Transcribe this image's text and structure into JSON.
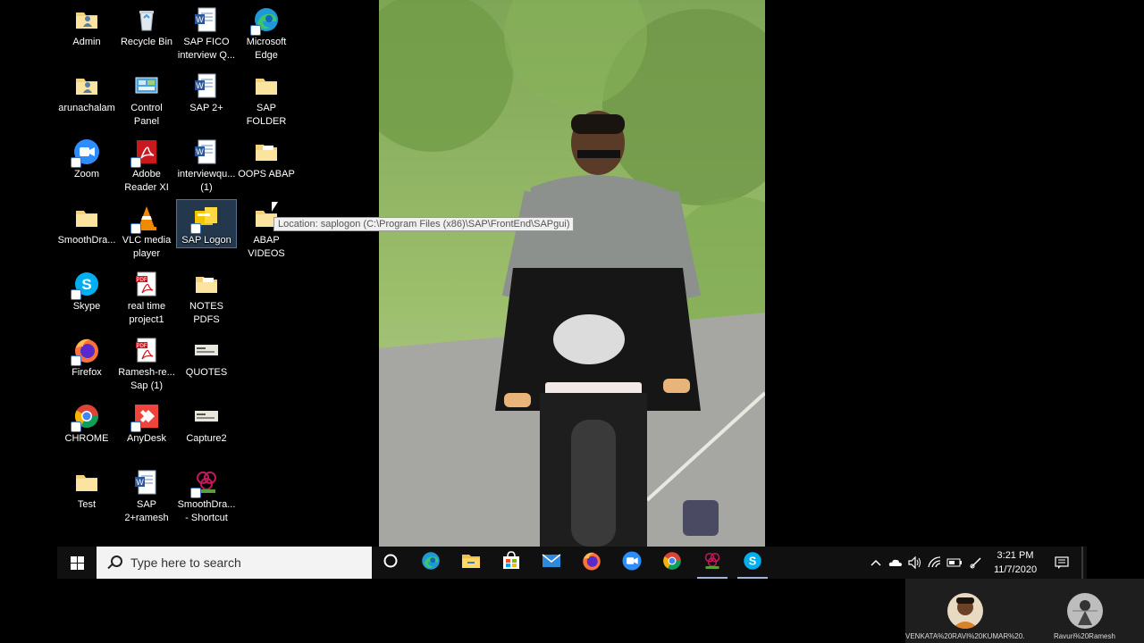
{
  "desktop_icons": [
    {
      "label": "Admin",
      "icon": "folder-user-icon"
    },
    {
      "label": "Recycle Bin",
      "icon": "recycle-bin-icon"
    },
    {
      "label": "SAP FICO interview Q...",
      "icon": "word-document-icon"
    },
    {
      "label": "Microsoft Edge",
      "icon": "edge-icon"
    },
    {
      "label": "arunachalam",
      "icon": "folder-user-icon"
    },
    {
      "label": "Control Panel",
      "icon": "control-panel-icon"
    },
    {
      "label": "SAP 2+",
      "icon": "word-document-icon"
    },
    {
      "label": "SAP FOLDER",
      "icon": "folder-icon"
    },
    {
      "label": "Zoom",
      "icon": "zoom-icon"
    },
    {
      "label": "Adobe Reader XI",
      "icon": "adobe-reader-icon"
    },
    {
      "label": "interviewqu... (1)",
      "icon": "word-document-icon"
    },
    {
      "label": "OOPS ABAP",
      "icon": "folder-doc-icon"
    },
    {
      "label": "SmoothDra...",
      "icon": "folder-icon"
    },
    {
      "label": "VLC media player",
      "icon": "vlc-icon"
    },
    {
      "label": "SAP Logon",
      "icon": "sap-logon-icon"
    },
    {
      "label": "ABAP VIDEOS",
      "icon": "folder-icon"
    },
    {
      "label": "Skype",
      "icon": "skype-icon"
    },
    {
      "label": "real time project1",
      "icon": "pdf-icon"
    },
    {
      "label": "NOTES PDFS",
      "icon": "folder-doc-icon"
    },
    {
      "label": "Firefox",
      "icon": "firefox-icon"
    },
    {
      "label": "Ramesh-re... Sap (1)",
      "icon": "pdf-icon"
    },
    {
      "label": "QUOTES",
      "icon": "image-file-icon"
    },
    {
      "label": "CHROME",
      "icon": "chrome-icon"
    },
    {
      "label": "AnyDesk",
      "icon": "anydesk-icon"
    },
    {
      "label": "Capture2",
      "icon": "image-file-icon"
    },
    {
      "label": "Test",
      "icon": "folder-icon"
    },
    {
      "label": "SAP 2+ramesh",
      "icon": "word-document-icon"
    },
    {
      "label": "SmoothDra... - Shortcut",
      "icon": "smoothdraw-icon"
    }
  ],
  "tooltip": "Location: saplogon (C:\\Program Files (x86)\\SAP\\FrontEnd\\SAPgui)",
  "taskbar": {
    "search_placeholder": "Type here to search",
    "apps": [
      "cortana-icon",
      "edge-icon",
      "file-explorer-icon",
      "store-icon",
      "mail-icon",
      "firefox-icon",
      "zoom-icon",
      "chrome-icon",
      "smoothdraw-icon",
      "skype-icon"
    ],
    "time": "3:21 PM",
    "date": "11/7/2020"
  },
  "participants": [
    {
      "name": "VENKATA%20RAVI%20KUMAR%20..."
    },
    {
      "name": "Ravuri%20Ramesh"
    }
  ],
  "colors": {
    "taskbar": "#101010",
    "search_bg": "#f3f3f3",
    "selection": "#66a0dc"
  }
}
